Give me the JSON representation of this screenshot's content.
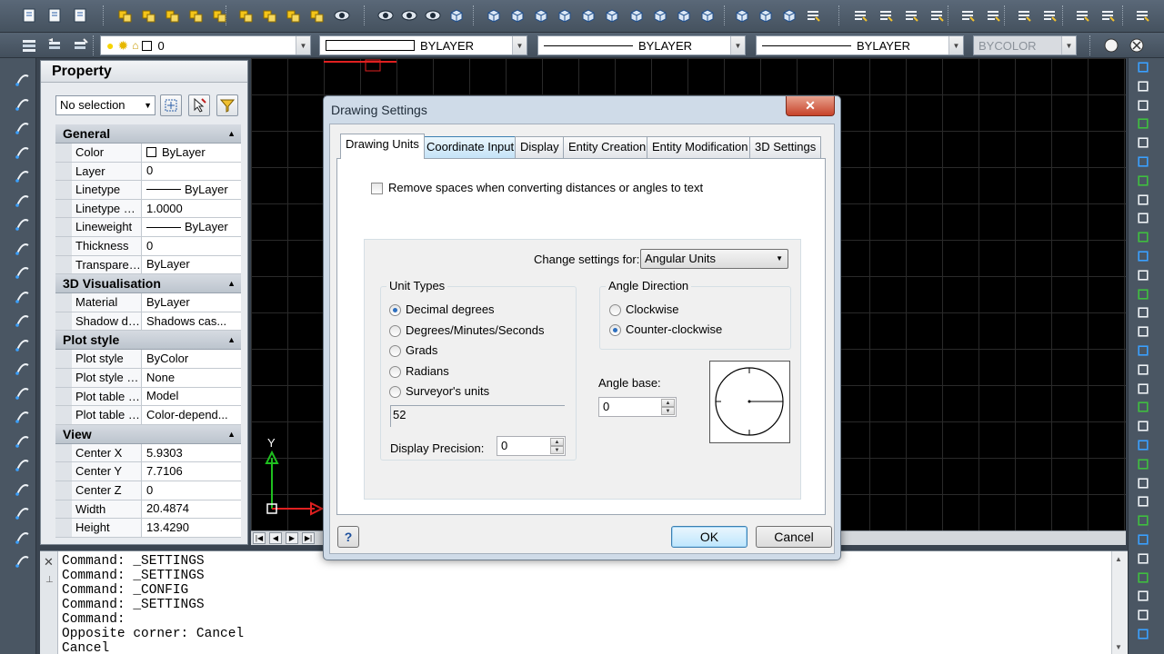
{
  "toolbar2": {
    "layer_value": "0",
    "color_value": "BYLAYER",
    "linetype_value": "BYLAYER",
    "lineweight_value": "BYLAYER",
    "plotstyle_value": "BYCOLOR"
  },
  "property_panel": {
    "title": "Property",
    "selection_combo": "No selection",
    "sections": [
      {
        "title": "General",
        "rows": [
          {
            "name": "Color",
            "value": "ByLayer"
          },
          {
            "name": "Layer",
            "value": "0"
          },
          {
            "name": "Linetype",
            "value": "ByLayer"
          },
          {
            "name": "Linetype scale",
            "value": "1.0000"
          },
          {
            "name": "Lineweight",
            "value": "ByLayer"
          },
          {
            "name": "Thickness",
            "value": "0"
          },
          {
            "name": "Transparency",
            "value": "ByLayer"
          }
        ]
      },
      {
        "title": "3D Visualisation",
        "rows": [
          {
            "name": "Material",
            "value": "ByLayer"
          },
          {
            "name": "Shadow displ...",
            "value": "Shadows cas..."
          }
        ]
      },
      {
        "title": "Plot style",
        "rows": [
          {
            "name": "Plot style",
            "value": "ByColor"
          },
          {
            "name": "Plot style table",
            "value": "None"
          },
          {
            "name": "Plot table att...",
            "value": "Model"
          },
          {
            "name": "Plot table type",
            "value": "Color-depend..."
          }
        ]
      },
      {
        "title": "View",
        "rows": [
          {
            "name": "Center X",
            "value": "5.9303"
          },
          {
            "name": "Center Y",
            "value": "7.7106"
          },
          {
            "name": "Center Z",
            "value": "0"
          },
          {
            "name": "Width",
            "value": "20.4874"
          },
          {
            "name": "Height",
            "value": "13.4290"
          }
        ]
      }
    ]
  },
  "ucs": {
    "y_label": "Y"
  },
  "command_line": {
    "lines": [
      "Command: _SETTINGS",
      "Command: _SETTINGS",
      "Command: _CONFIG",
      "Command: _SETTINGS",
      "Command:",
      "Opposite corner: Cancel",
      "Cancel"
    ]
  },
  "dialog": {
    "title": "Drawing Settings",
    "close_glyph": "✕",
    "tabs": [
      "Drawing Units",
      "Coordinate Input",
      "Display",
      "Entity Creation",
      "Entity Modification",
      "3D Settings"
    ],
    "remove_spaces_label": "Remove spaces when converting distances or angles to text",
    "change_settings_label": "Change settings for:",
    "change_settings_value": "Angular Units",
    "unit_types_label": "Unit Types",
    "unit_types": [
      "Decimal degrees",
      "Degrees/Minutes/Seconds",
      "Grads",
      "Radians",
      "Surveyor's units"
    ],
    "selected_unit_type": "Decimal degrees",
    "sample_value": "52",
    "display_precision_label": "Display Precision:",
    "display_precision_value": "0",
    "angle_direction_label": "Angle Direction",
    "angle_directions": [
      "Clockwise",
      "Counter-clockwise"
    ],
    "selected_angle_direction": "Counter-clockwise",
    "angle_base_label": "Angle base:",
    "angle_base_value": "0",
    "help_glyph": "?",
    "ok_label": "OK",
    "cancel_label": "Cancel"
  },
  "colors": {
    "workspace_bg": "#000000",
    "grid_line": "#2a2a2a",
    "ucs_y_axis": "#1fbf1f",
    "ucs_x_axis": "#e02020",
    "dialog_frame": "#cfdbe8",
    "close_button": "#c7432a",
    "default_button": "#bee6fd"
  }
}
